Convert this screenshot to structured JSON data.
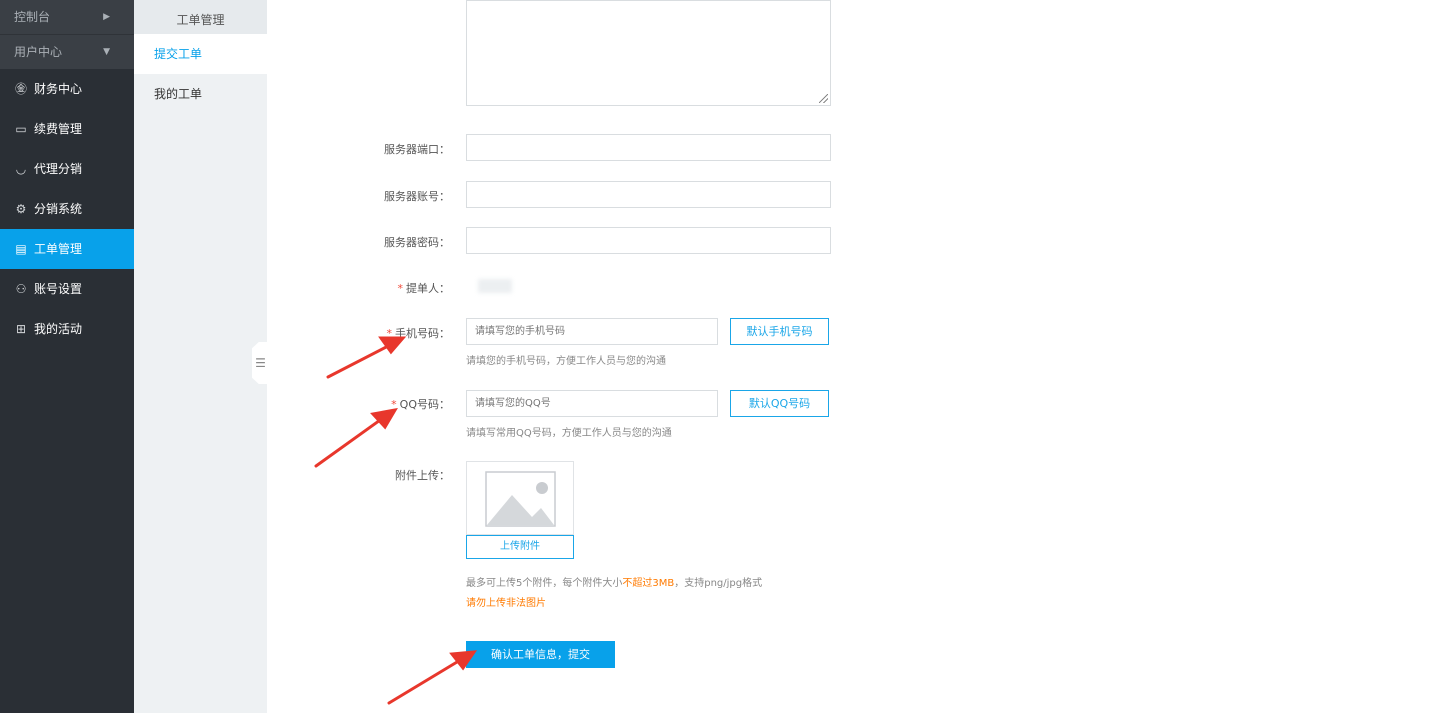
{
  "sidebar": {
    "headers": [
      {
        "label": "控制台",
        "arrow": "▶"
      },
      {
        "label": "用户中心",
        "arrow": "▼"
      }
    ],
    "items": [
      {
        "label": "财务中心",
        "icon": "yen-circle-icon",
        "glyph": "㊎"
      },
      {
        "label": "续费管理",
        "icon": "calendar-icon",
        "glyph": "▭"
      },
      {
        "label": "代理分销",
        "icon": "basket-icon",
        "glyph": "◡"
      },
      {
        "label": "分销系统",
        "icon": "gear-icon",
        "glyph": "⚙"
      },
      {
        "label": "工单管理",
        "icon": "document-icon",
        "glyph": "▤"
      },
      {
        "label": "账号设置",
        "icon": "user-icon",
        "glyph": "⚇"
      },
      {
        "label": "我的活动",
        "icon": "gift-icon",
        "glyph": "⊞"
      }
    ],
    "active_index": 4
  },
  "subnav": {
    "title": "工单管理",
    "items": [
      {
        "label": "提交工单"
      },
      {
        "label": "我的工单"
      }
    ]
  },
  "form": {
    "server_port_label": "服务器端口：",
    "server_account_label": "服务器账号：",
    "server_password_label": "服务器密码：",
    "submitter_label": "提单人：",
    "phone_label": "手机号码：",
    "phone_placeholder": "请填写您的手机号码",
    "phone_default_button": "默认手机号码",
    "phone_hint": "请填您的手机号码，方便工作人员与您的沟通",
    "qq_label": "QQ号码：",
    "qq_placeholder": "请填写您的QQ号",
    "qq_default_button": "默认QQ号码",
    "qq_hint": "请填写常用QQ号码，方便工作人员与您的沟通",
    "attachment_label": "附件上传：",
    "upload_button": "上传附件",
    "upload_hint_prefix": "最多可上传5个附件，每个附件大小",
    "upload_hint_highlight": "不超过3MB",
    "upload_hint_suffix": "，支持png/jpg格式",
    "upload_warning": "请勿上传非法图片",
    "submit_button": "确认工单信息，提交",
    "required_mark": "*"
  },
  "colors": {
    "accent": "#08a1ea",
    "sidebar_bg": "#2a2f35",
    "warning": "#ff7a00",
    "required": "#f04b3b",
    "annotation_arrow": "#e8372c"
  }
}
